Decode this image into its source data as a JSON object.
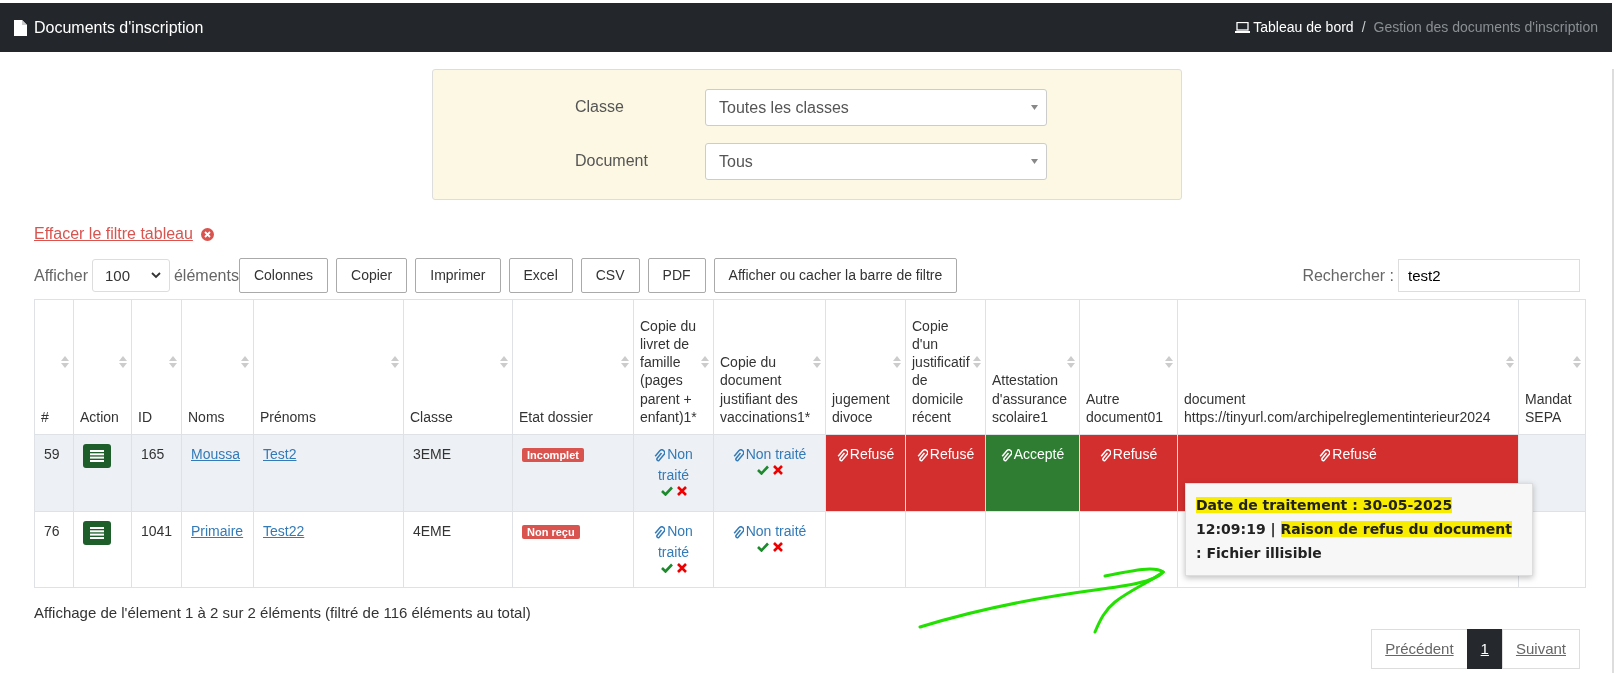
{
  "header": {
    "title": "Documents d'inscription",
    "breadcrumb": [
      {
        "label": "Tableau de bord",
        "active": false
      },
      {
        "label": "Gestion des documents d'inscription",
        "active": true
      }
    ],
    "breadcrumb_separator": "/"
  },
  "filters": [
    {
      "label": "Classe",
      "value": "Toutes les classes"
    },
    {
      "label": "Document",
      "value": "Tous"
    }
  ],
  "clear_filter": "Effacer le filtre tableau",
  "length": {
    "before": "Afficher",
    "value": "100",
    "after": "éléments"
  },
  "buttons": [
    "Colonnes",
    "Copier",
    "Imprimer",
    "Excel",
    "CSV",
    "PDF",
    "Afficher ou cacher la barre de filtre"
  ],
  "search": {
    "label": "Rechercher :",
    "value": "test2"
  },
  "table": {
    "columns": [
      "#",
      "Action",
      "ID",
      "Noms",
      "Prénoms",
      "Classe",
      "Etat dossier",
      "Copie du livret de famille (pages parent + enfant)1*",
      "Copie du document justifiant des vaccinations1*",
      "jugement divoce",
      "Copie d'un justificatif de domicile récent",
      "Attestation d'assurance scolaire1",
      "Autre document01",
      "document https://tinyurl.com/archipelreglementinterieur2024",
      "Mandat SEPA"
    ],
    "rows": [
      {
        "num": "59",
        "id": "165",
        "nom": "Moussa",
        "prenom": "Test2",
        "classe": "3EME",
        "etat": "Incomplet",
        "selected": true,
        "docs": [
          {
            "kind": "pending",
            "label": "Non traité"
          },
          {
            "kind": "pending",
            "label": "Non traité"
          },
          {
            "kind": "refused",
            "label": "Refusé"
          },
          {
            "kind": "refused",
            "label": "Refusé"
          },
          {
            "kind": "accepted",
            "label": "Accepté"
          },
          {
            "kind": "refused",
            "label": "Refusé"
          },
          {
            "kind": "refused",
            "label": "Refusé"
          },
          {
            "kind": "empty"
          }
        ]
      },
      {
        "num": "76",
        "id": "1041",
        "nom": "Primaire",
        "prenom": "Test22",
        "classe": "4EME",
        "etat": "Non reçu",
        "selected": false,
        "docs": [
          {
            "kind": "pending",
            "label": "Non traité"
          },
          {
            "kind": "pending",
            "label": "Non traité"
          },
          {
            "kind": "empty"
          },
          {
            "kind": "empty"
          },
          {
            "kind": "empty"
          },
          {
            "kind": "empty"
          },
          {
            "kind": "empty"
          },
          {
            "kind": "empty"
          }
        ]
      }
    ]
  },
  "tooltip": {
    "segments": [
      {
        "text": "Date de traitement : 30-05-2025",
        "highlighted": true
      },
      {
        "text": "12:09:19 |",
        "highlighted": false
      },
      {
        "text": "Raison de refus du document",
        "highlighted": true
      },
      {
        "text": ": Fichier illisible",
        "highlighted": false
      }
    ]
  },
  "info": "Affichage de l'élement 1 à 2 sur 2 éléments (filtré de 116 éléments au total)",
  "pagination": [
    {
      "label": "Précédent",
      "selected": false
    },
    {
      "label": "1",
      "selected": true
    },
    {
      "label": "Suivant",
      "selected": false
    }
  ]
}
